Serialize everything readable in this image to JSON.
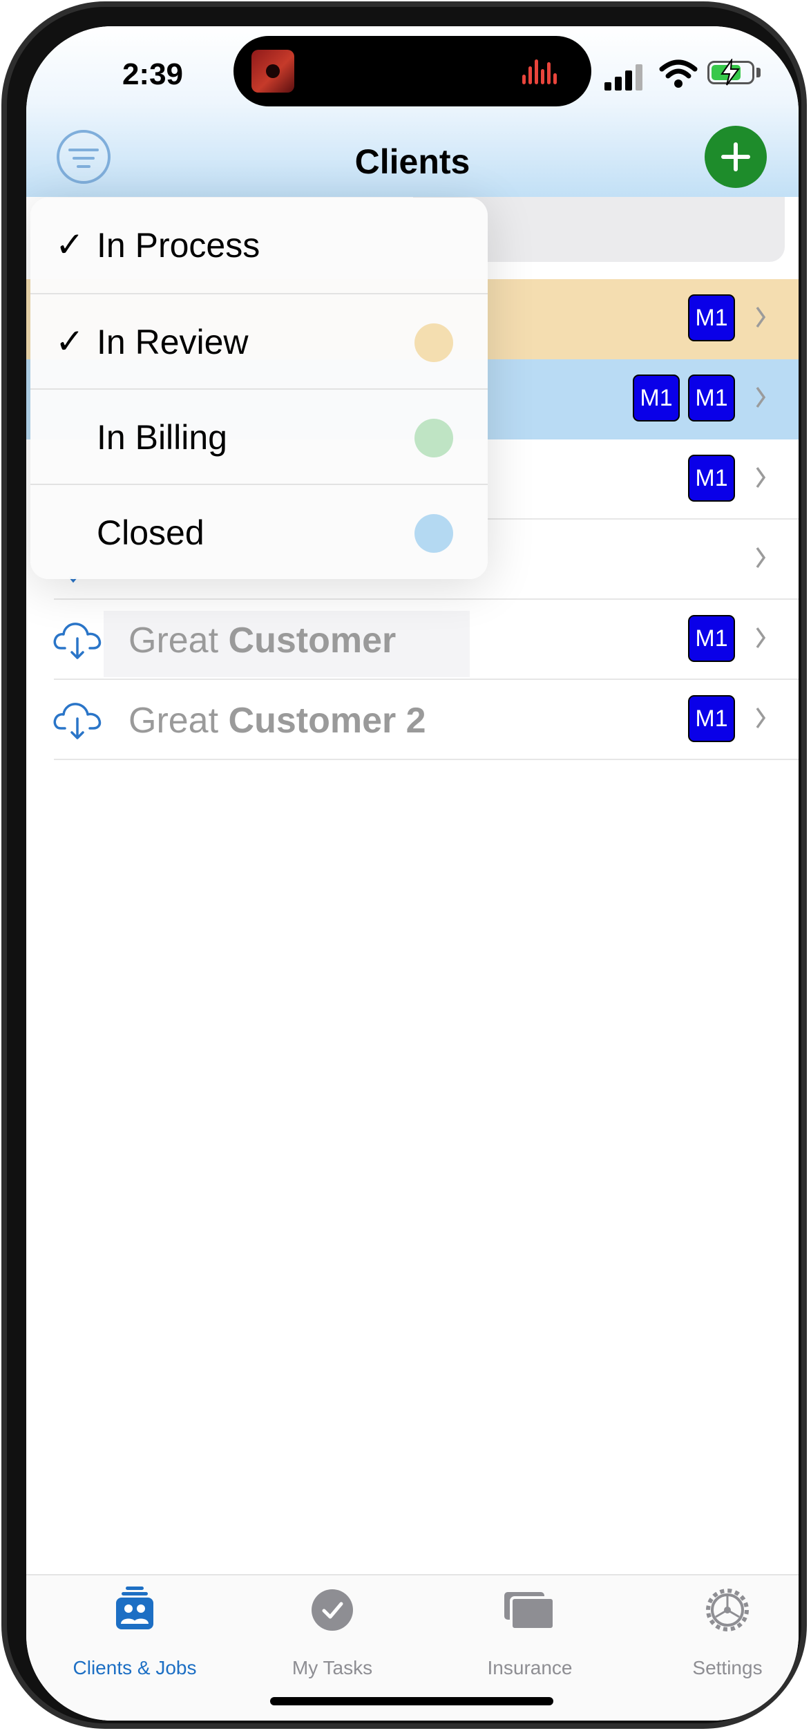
{
  "status_bar": {
    "time": "2:39"
  },
  "nav": {
    "title": "Clients"
  },
  "filter_menu": {
    "items": [
      {
        "label": "In Process",
        "checked": true,
        "color": null
      },
      {
        "label": "In Review",
        "checked": true,
        "color": "#f4deb0"
      },
      {
        "label": "In Billing",
        "checked": false,
        "color": "#bfe4c4"
      },
      {
        "label": "Closed",
        "checked": false,
        "color": "#b4d9f2"
      }
    ],
    "check_glyph": "✓"
  },
  "client_rows": [
    {
      "status": "in-review",
      "badges": [
        "M1"
      ]
    },
    {
      "status": "in-process",
      "badges": [
        "M1",
        "M1"
      ]
    },
    {
      "status": "none",
      "badges": [
        "M1"
      ]
    },
    {
      "status": "none",
      "badges": []
    },
    {
      "status": "none",
      "badges": [
        "M1"
      ],
      "name_light": "Great",
      "name_bold": "Customer",
      "icon": "cloud-download-icon"
    },
    {
      "status": "none",
      "badges": [
        "M1"
      ],
      "name_light": "Great",
      "name_bold": "Customer 2",
      "icon": "cloud-download-icon"
    }
  ],
  "tabs": [
    {
      "label": "Clients & Jobs",
      "icon": "clients-jobs-icon",
      "active": true
    },
    {
      "label": "My Tasks",
      "icon": "checkmark-circle-icon",
      "active": false
    },
    {
      "label": "Insurance",
      "icon": "stacked-cards-icon",
      "active": false
    },
    {
      "label": "Settings",
      "icon": "gear-icon",
      "active": false
    }
  ],
  "colors": {
    "accent_blue": "#1d6fc4",
    "add_green": "#1e8c2b",
    "badge_blue": "#0a00e8",
    "in_review_bg": "#f4ddb0",
    "in_process_bg": "#b9dbf4"
  }
}
